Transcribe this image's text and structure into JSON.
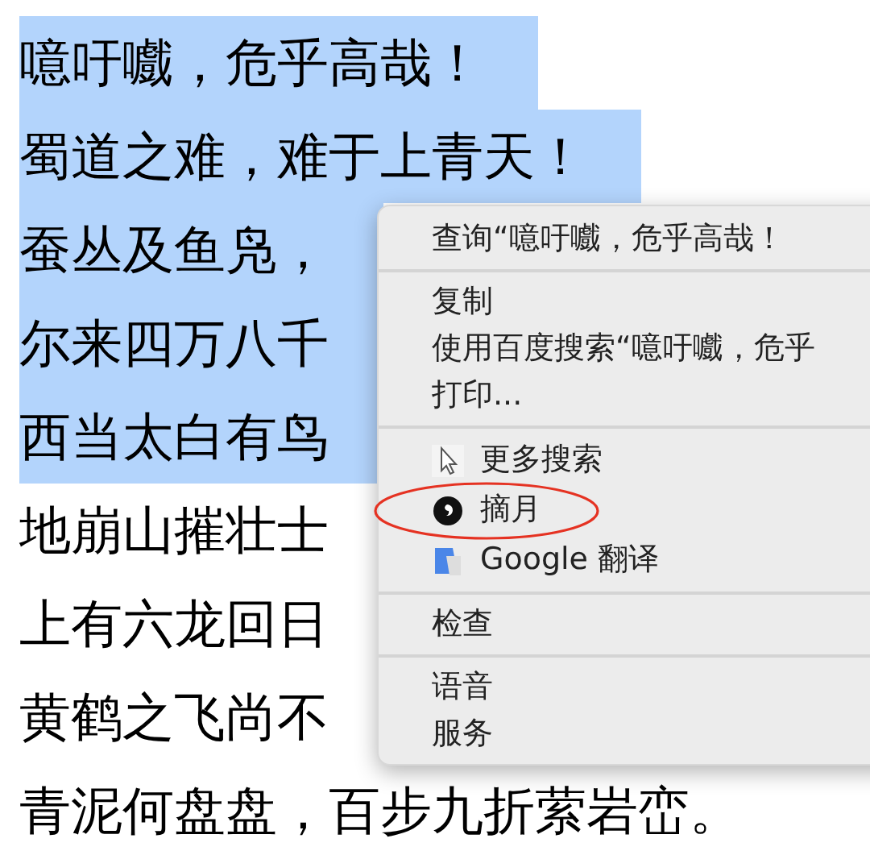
{
  "poem_lines": [
    {
      "text": "噫吁嚱，危乎高哉！",
      "selected": true
    },
    {
      "text": "蜀道之难，难于上青天！",
      "selected": true
    },
    {
      "text": "蚕丛及鱼凫，",
      "selected": true
    },
    {
      "text": "尔来四万八千",
      "selected": true
    },
    {
      "text": "西当太白有鸟",
      "selected": true
    },
    {
      "text": "地崩山摧壮士",
      "selected": false
    },
    {
      "text": "上有六龙回日",
      "selected": false
    },
    {
      "text": "黄鹤之飞尚不",
      "selected": false
    },
    {
      "text": "青泥何盘盘，百步九折萦岩峦。",
      "selected": false
    }
  ],
  "context_menu": {
    "groups": [
      [
        {
          "label": "查询“噫吁嚱，危乎高哉！",
          "kind": "text"
        }
      ],
      [
        {
          "label": "复制",
          "kind": "text"
        },
        {
          "label": "使用百度搜索“噫吁嚱，危乎",
          "kind": "text"
        },
        {
          "label": "打印...",
          "kind": "text"
        }
      ],
      [
        {
          "label": "更多搜索",
          "kind": "cursor"
        },
        {
          "label": "摘月",
          "kind": "moon",
          "circled": true
        },
        {
          "label": "Google 翻译",
          "kind": "translate"
        }
      ],
      [
        {
          "label": "检查",
          "kind": "text"
        }
      ],
      [
        {
          "label": "语音",
          "kind": "text"
        },
        {
          "label": "服务",
          "kind": "text"
        }
      ]
    ]
  }
}
